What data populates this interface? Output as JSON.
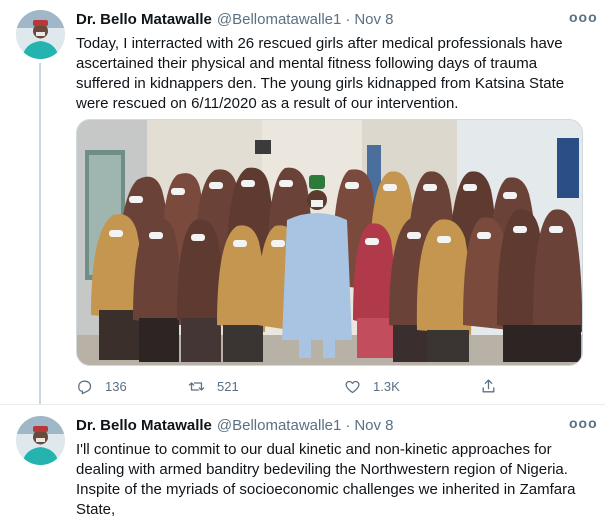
{
  "tweets": [
    {
      "author_name": "Dr. Bello Matawalle",
      "handle": "@Bellomatawalle1",
      "separator": "·",
      "date": "Nov 8",
      "more_label": "ooo",
      "text": "Today, I interracted with 26 rescued girls after medical professionals have ascertained their physical and mental fitness following days of trauma suffered in kidnappers den. The young girls kidnapped from Katsina State were rescued on 6/11/2020 as a result of our intervention.",
      "replies": "136",
      "retweets": "521",
      "likes": "1.3K"
    },
    {
      "author_name": "Dr. Bello Matawalle",
      "handle": "@Bellomatawalle1",
      "separator": "·",
      "date": "Nov 8",
      "more_label": "ooo",
      "text": "I'll continue to commit to our dual kinetic and non-kinetic approaches for dealing with armed banditry bedeviling the Northwestern region of Nigeria. Inspite of the myriads of socioeconomic challenges we inherited in Zamfara State,"
    }
  ],
  "colors": {
    "secondary_text": "#5b7083",
    "thread_line": "#ccd6dd",
    "divider": "#e6ecf0",
    "hijab_brown": "#6b4238",
    "hijab_tan": "#c4964f",
    "kaftan_blue": "#a9c4e2"
  },
  "icons": [
    "reply-icon",
    "retweet-icon",
    "like-icon",
    "share-icon",
    "more-icon"
  ]
}
